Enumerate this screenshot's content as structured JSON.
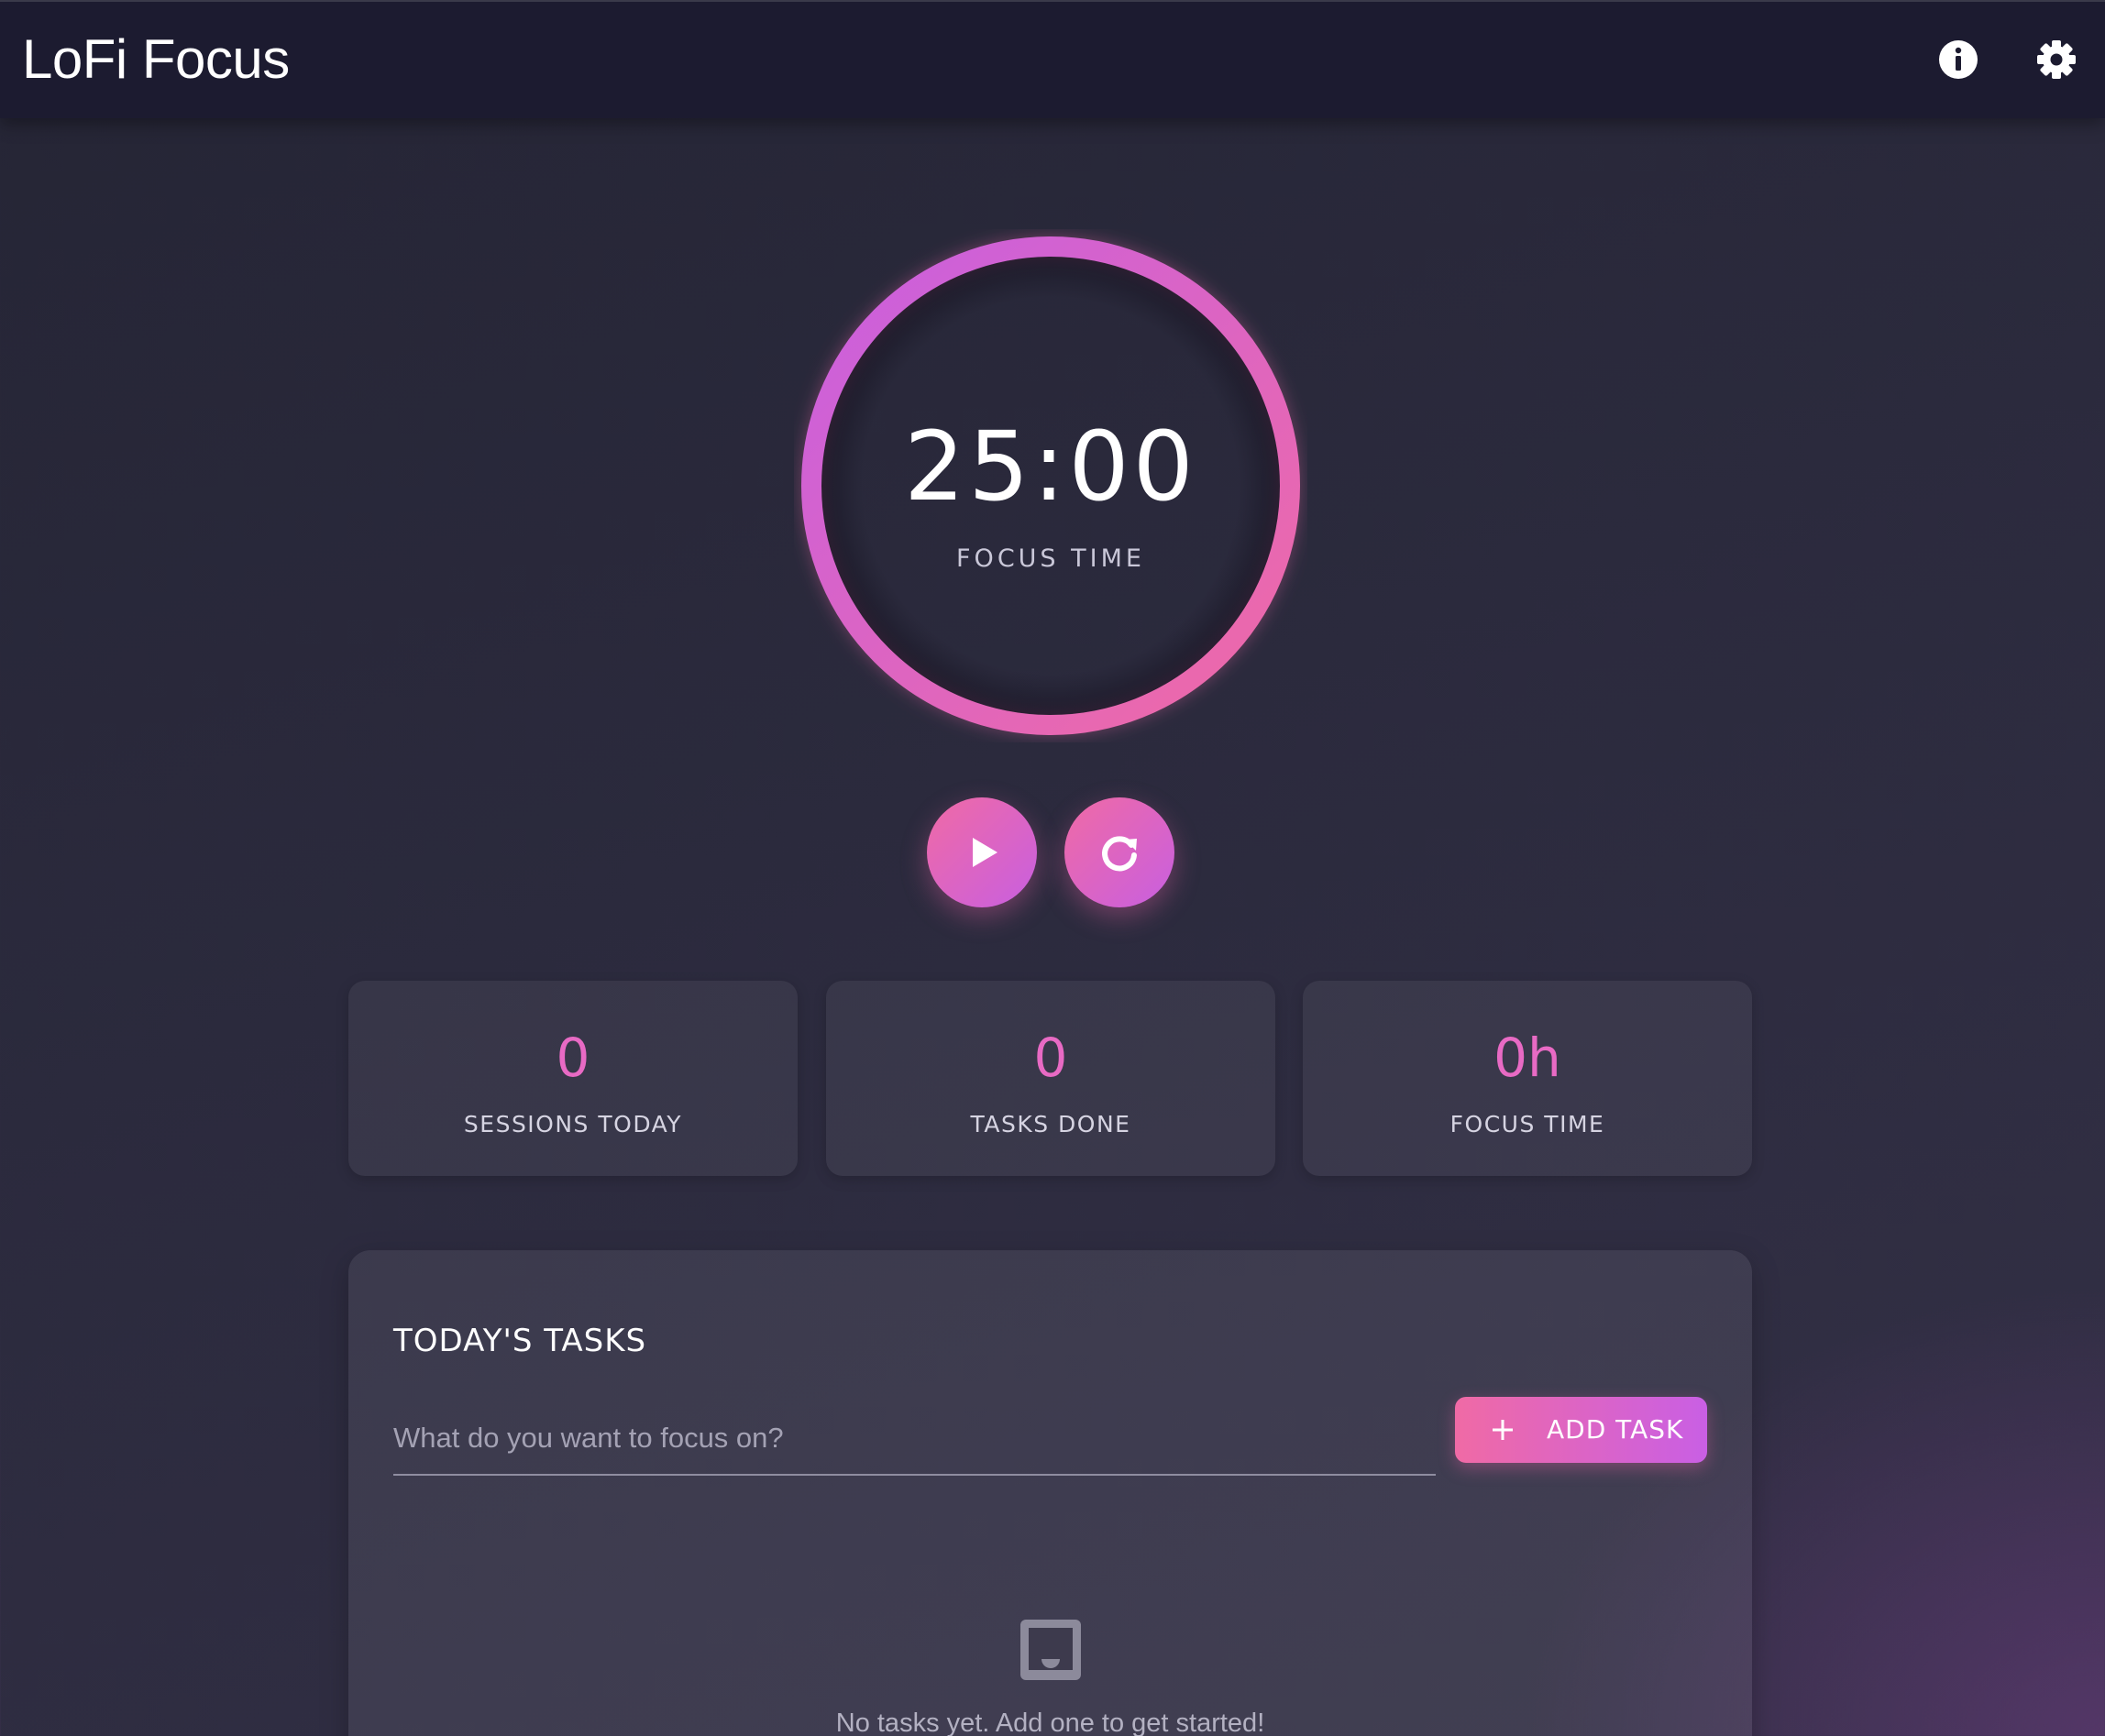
{
  "app": {
    "title": "LoFi Focus",
    "header_icons": [
      "info-icon",
      "gear-icon"
    ]
  },
  "timer": {
    "time": "25:00",
    "mode_label": "FOCUS TIME",
    "progress": 1.0,
    "ring_colors": [
      "#f06aa5",
      "#c85fe0"
    ]
  },
  "controls": {
    "play_icon": "play-icon",
    "reset_icon": "refresh-icon"
  },
  "stats": [
    {
      "value": "0",
      "label": "SESSIONS TODAY"
    },
    {
      "value": "0",
      "label": "TASKS DONE"
    },
    {
      "value": "0h",
      "label": "FOCUS TIME"
    }
  ],
  "tasks": {
    "title": "TODAY'S TASKS",
    "input_value": "",
    "input_placeholder": "What do you want to focus on?",
    "add_button_label": "ADD TASK",
    "add_button_icon": "plus-icon",
    "empty_icon": "inbox-icon",
    "empty_message": "No tasks yet. Add one to get started!"
  },
  "colors": {
    "accent_pink": "#f06aa5",
    "accent_purple": "#c85fe0",
    "stat_value": "#e86ac4",
    "appbar_bg": "#1c1b30"
  }
}
